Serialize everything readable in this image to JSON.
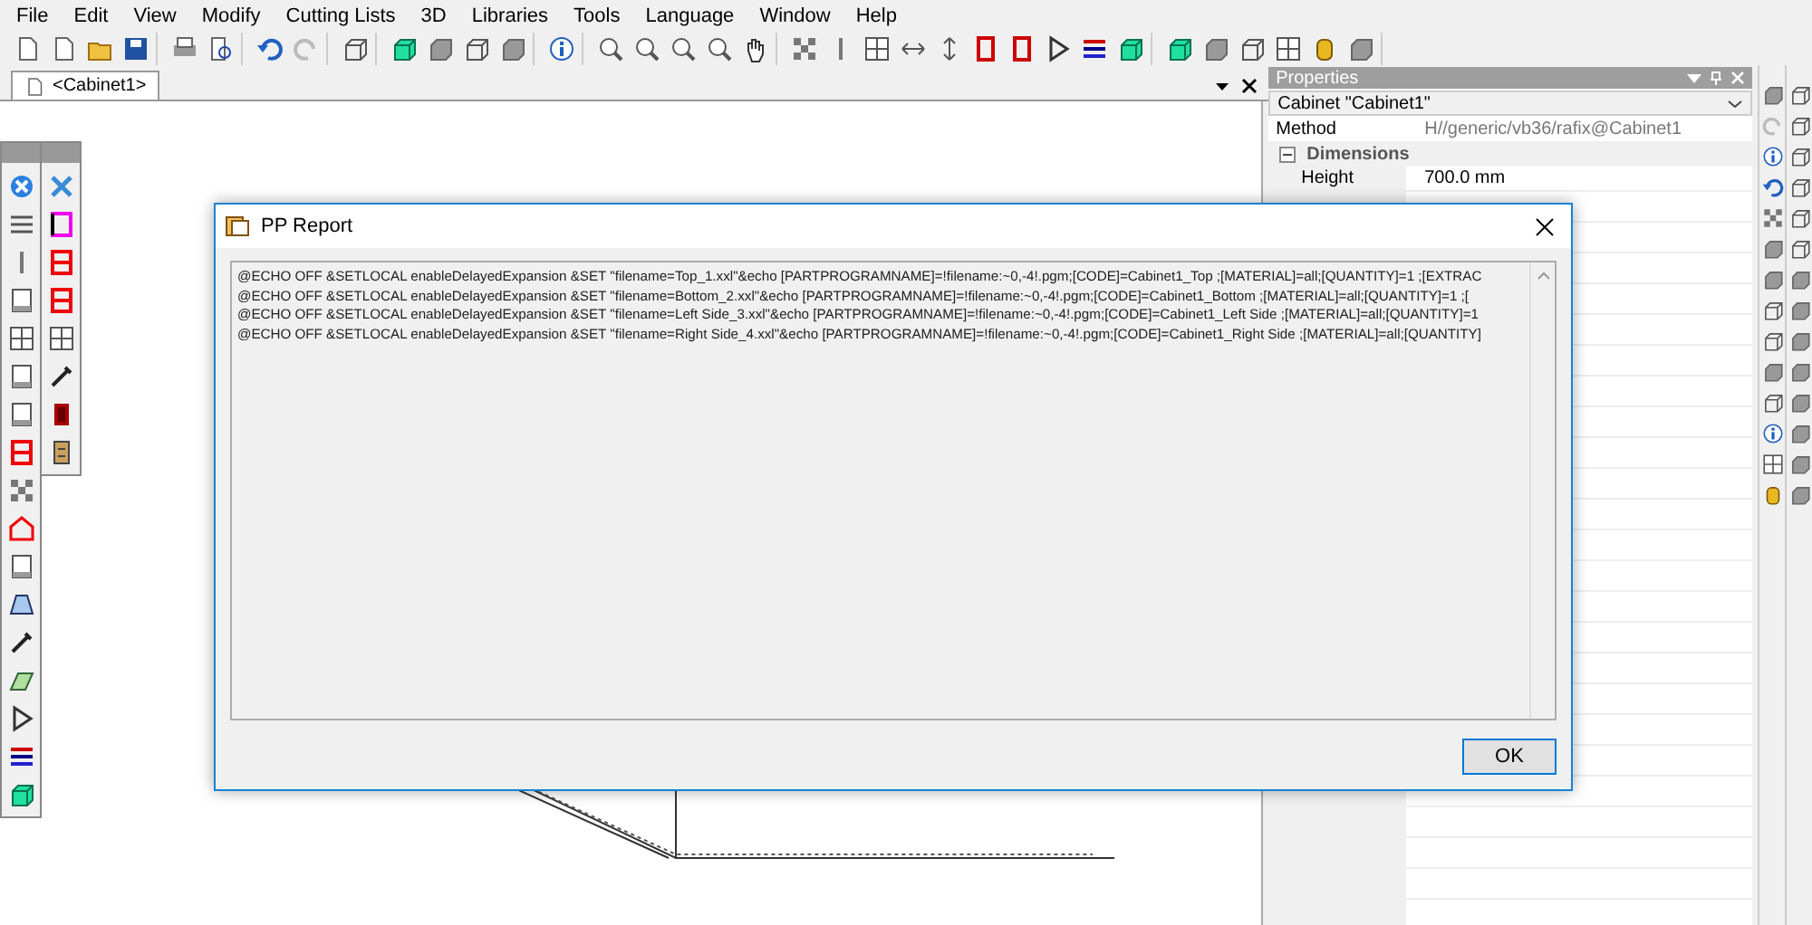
{
  "menu": [
    "File",
    "Edit",
    "View",
    "Modify",
    "Cutting Lists",
    "3D",
    "Libraries",
    "Tools",
    "Language",
    "Window",
    "Help"
  ],
  "document_tab": {
    "label": "<Cabinet1>",
    "selected": true
  },
  "properties": {
    "title": "Properties",
    "object": "Cabinet \"Cabinet1\"",
    "rows": [
      {
        "kind": "field",
        "label": "Method",
        "value": "H//generic/vb36/rafix@Cabinet1"
      },
      {
        "kind": "group",
        "label": "Dimensions",
        "expanded": true
      },
      {
        "kind": "field",
        "label": "Height",
        "value": "700.0 mm"
      }
    ]
  },
  "dialog": {
    "title": "PP Report",
    "lines": [
      "@ECHO OFF &SETLOCAL enableDelayedExpansion &SET \"filename=Top_1.xxl\"&echo [PARTPROGRAMNAME]=!filename:~0,-4!.pgm;[CODE]=Cabinet1_Top ;[MATERIAL]=all;[QUANTITY]=1 ;[EXTRAC",
      "@ECHO OFF &SETLOCAL enableDelayedExpansion &SET \"filename=Bottom_2.xxl\"&echo [PARTPROGRAMNAME]=!filename:~0,-4!.pgm;[CODE]=Cabinet1_Bottom ;[MATERIAL]=all;[QUANTITY]=1 ;[",
      "@ECHO OFF &SETLOCAL enableDelayedExpansion &SET \"filename=Left Side_3.xxl\"&echo [PARTPROGRAMNAME]=!filename:~0,-4!.pgm;[CODE]=Cabinet1_Left Side ;[MATERIAL]=all;[QUANTITY]=1",
      "@ECHO OFF &SETLOCAL enableDelayedExpansion &SET \"filename=Right Side_4.xxl\"&echo [PARTPROGRAMNAME]=!filename:~0,-4!.pgm;[CODE]=Cabinet1_Right Side ;[MATERIAL]=all;[QUANTITY]"
    ],
    "buttons": [
      "OK"
    ]
  }
}
